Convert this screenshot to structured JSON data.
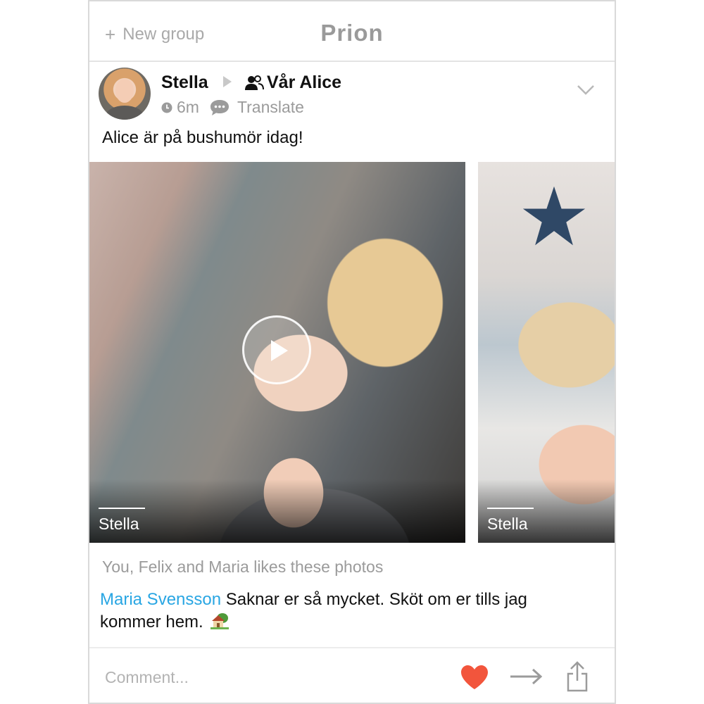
{
  "header": {
    "new_group_icon": "plus-icon",
    "new_group_label": "New group",
    "app_title": "Prion"
  },
  "post": {
    "author": "Stella",
    "group_icon": "group-icon",
    "group": "Vår Alice",
    "time": "6m",
    "translate_label": "Translate",
    "text": "Alice är på bushumör idag!",
    "media": [
      {
        "type": "video",
        "caption": "Stella"
      },
      {
        "type": "photo",
        "caption": "Stella"
      }
    ],
    "likes_text": "You, Felix and Maria likes these photos",
    "comment": {
      "author": "Maria Svensson",
      "text": "Saknar er så mycket. Sköt om er tills jag kommer hem.",
      "emoji_icon": "house-with-garden-icon"
    }
  },
  "actions": {
    "comment_placeholder": "Comment...",
    "like_icon": "heart-icon",
    "forward_icon": "arrow-right-icon",
    "share_icon": "share-icon"
  },
  "colors": {
    "accent_link": "#29a6e3",
    "heart": "#f2553c",
    "muted_text": "#9b9b9b"
  }
}
